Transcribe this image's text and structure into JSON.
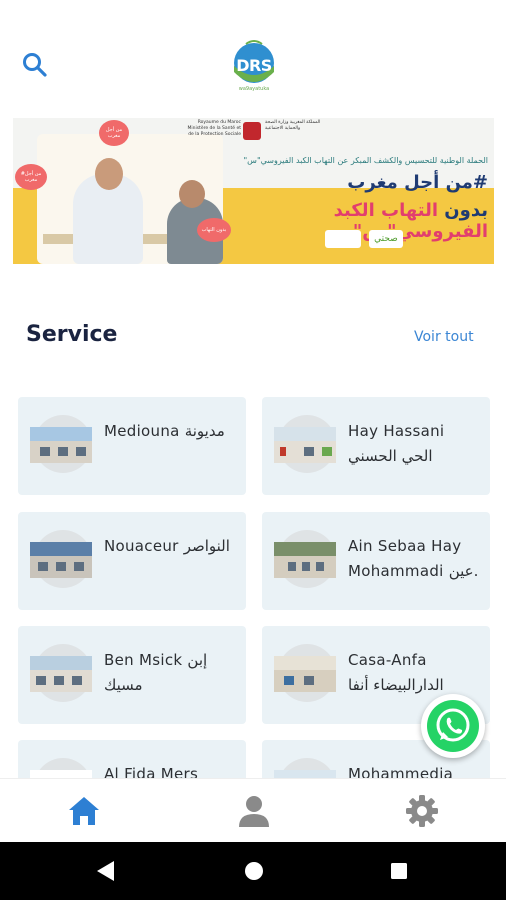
{
  "header": {
    "logo_text": "DRS",
    "logo_subtitle": "wa9ayatuka"
  },
  "banner": {
    "ministry_fr": "Royaume du Maroc Ministère de la Santé et de la Protection Sociale",
    "ministry_ar": "المملكة المغربية وزارة الصحة والحماية الاجتماعية",
    "campaign_line": "الحملة الوطنية للتحسيس والكشف المبكر عن التهاب الكبد الفيروسي\"س\"",
    "title_line1": "#من أجل مغرب",
    "title_line2_a": "بدون ",
    "title_line2_b": "التهاب الكبد الفيروسي\"س\"",
    "partner_logo": "صحتي",
    "bubble1": "من أجل مغرب",
    "bubble2": "#من أجل مغرب",
    "bubble3": "بدون التهاب"
  },
  "section": {
    "title": "Service",
    "see_all": "Voir tout"
  },
  "services": [
    {
      "line1": "Mediouna مديونة",
      "line2": ""
    },
    {
      "line1": "Hay Hassani",
      "line2": "الحي الحسني"
    },
    {
      "line1": "Nouaceur النواصر",
      "line2": ""
    },
    {
      "line1": "Ain Sebaa Hay",
      "line2": "Mohammadi عين."
    },
    {
      "line1": "Ben Msick إبن",
      "line2": "مسيك"
    },
    {
      "line1": "Casa-Anfa",
      "line2": "الدارالبيضاء أنفا"
    },
    {
      "line1": "Al Fida Mers",
      "line2": ""
    },
    {
      "line1": "Mohammedia",
      "line2": ""
    }
  ],
  "colors": {
    "accent": "#3b86d4",
    "card_bg": "#eaf2f6",
    "title": "#1a2340",
    "whatsapp": "#25d366",
    "nav_active": "#2d7fd3",
    "nav_inactive": "#8a8a8a"
  },
  "nav": {
    "home_icon": "home-icon",
    "profile_icon": "user-icon",
    "settings_icon": "gear-icon"
  }
}
